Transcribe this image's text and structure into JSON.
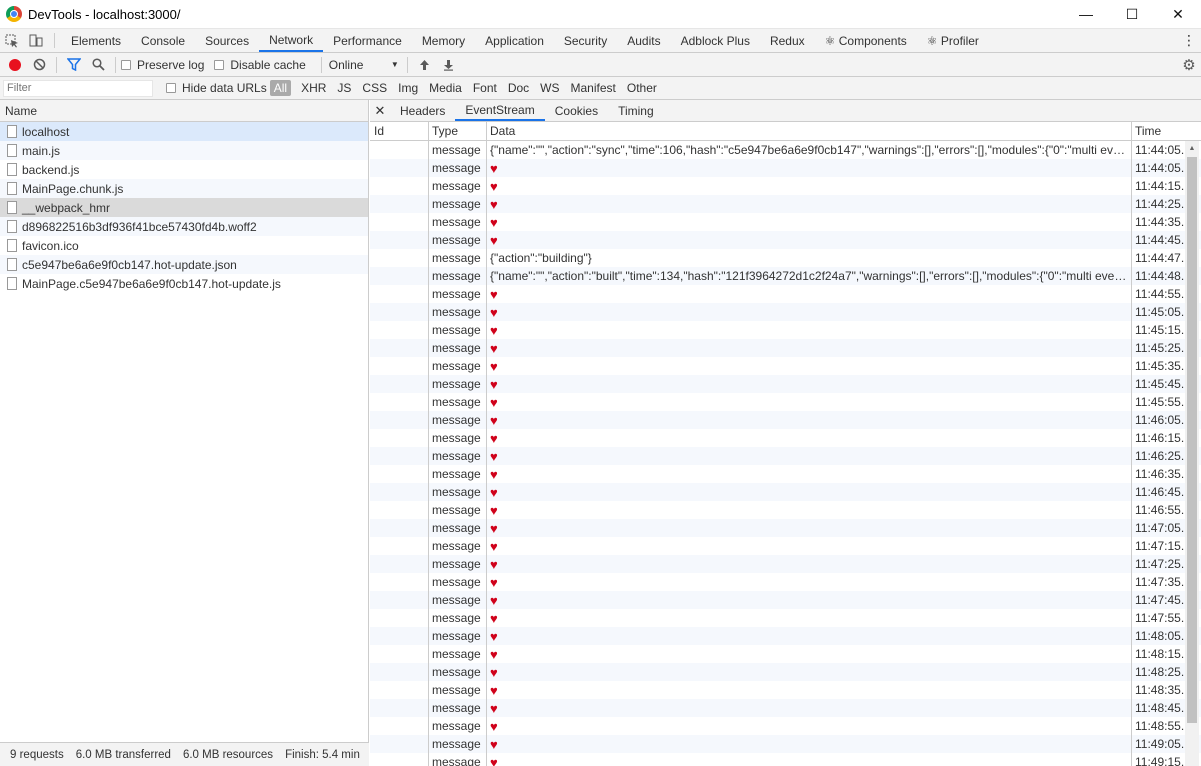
{
  "window": {
    "title": "DevTools - localhost:3000/",
    "minimize": "—",
    "maximize": "☐",
    "close": "✕"
  },
  "tabs": [
    "Elements",
    "Console",
    "Sources",
    "Network",
    "Performance",
    "Memory",
    "Application",
    "Security",
    "Audits",
    "Adblock Plus",
    "Redux",
    "⚛ Components",
    "⚛ Profiler"
  ],
  "active_tab": "Network",
  "toolbar": {
    "preserve_log": "Preserve log",
    "disable_cache": "Disable cache",
    "throttle": "Online"
  },
  "filterbar": {
    "placeholder": "Filter",
    "hide_data_urls": "Hide data URLs",
    "types": [
      "All",
      "XHR",
      "JS",
      "CSS",
      "Img",
      "Media",
      "Font",
      "Doc",
      "WS",
      "Manifest",
      "Other"
    ]
  },
  "requests": {
    "header": "Name",
    "items": [
      "localhost",
      "main.js",
      "backend.js",
      "MainPage.chunk.js",
      "__webpack_hmr",
      "d896822516b3df936f41bce57430fd4b.woff2",
      "favicon.ico",
      "c5e947be6a6e9f0cb147.hot-update.json",
      "MainPage.c5e947be6a6e9f0cb147.hot-update.js"
    ]
  },
  "status": {
    "requests": "9 requests",
    "transferred": "6.0 MB transferred",
    "resources": "6.0 MB resources",
    "finish": "Finish: 5.4 min",
    "more": "D"
  },
  "detail_tabs": [
    "Headers",
    "EventStream",
    "Cookies",
    "Timing"
  ],
  "active_detail_tab": "EventStream",
  "events": {
    "columns": [
      "Id",
      "Type",
      "Data",
      "Time"
    ],
    "rows": [
      {
        "type": "message",
        "data": "{\"name\":\"\",\"action\":\"sync\",\"time\":106,\"hash\":\"c5e947be6a6e9f0cb147\",\"warnings\":[],\"errors\":[],\"modules\":{\"0\":\"multi eventsource-poly...",
        "time": "11:44:05..."
      },
      {
        "type": "message",
        "data": "♥",
        "time": "11:44:05..."
      },
      {
        "type": "message",
        "data": "♥",
        "time": "11:44:15..."
      },
      {
        "type": "message",
        "data": "♥",
        "time": "11:44:25..."
      },
      {
        "type": "message",
        "data": "♥",
        "time": "11:44:35..."
      },
      {
        "type": "message",
        "data": "♥",
        "time": "11:44:45..."
      },
      {
        "type": "message",
        "data": "{\"action\":\"building\"}",
        "time": "11:44:47..."
      },
      {
        "type": "message",
        "data": "{\"name\":\"\",\"action\":\"built\",\"time\":134,\"hash\":\"121f3964272d1c2f24a7\",\"warnings\":[],\"errors\":[],\"modules\":{\"0\":\"multi eventsource-poly...",
        "time": "11:44:48..."
      },
      {
        "type": "message",
        "data": "♥",
        "time": "11:44:55..."
      },
      {
        "type": "message",
        "data": "♥",
        "time": "11:45:05..."
      },
      {
        "type": "message",
        "data": "♥",
        "time": "11:45:15..."
      },
      {
        "type": "message",
        "data": "♥",
        "time": "11:45:25..."
      },
      {
        "type": "message",
        "data": "♥",
        "time": "11:45:35..."
      },
      {
        "type": "message",
        "data": "♥",
        "time": "11:45:45..."
      },
      {
        "type": "message",
        "data": "♥",
        "time": "11:45:55..."
      },
      {
        "type": "message",
        "data": "♥",
        "time": "11:46:05..."
      },
      {
        "type": "message",
        "data": "♥",
        "time": "11:46:15..."
      },
      {
        "type": "message",
        "data": "♥",
        "time": "11:46:25..."
      },
      {
        "type": "message",
        "data": "♥",
        "time": "11:46:35..."
      },
      {
        "type": "message",
        "data": "♥",
        "time": "11:46:45..."
      },
      {
        "type": "message",
        "data": "♥",
        "time": "11:46:55..."
      },
      {
        "type": "message",
        "data": "♥",
        "time": "11:47:05..."
      },
      {
        "type": "message",
        "data": "♥",
        "time": "11:47:15..."
      },
      {
        "type": "message",
        "data": "♥",
        "time": "11:47:25..."
      },
      {
        "type": "message",
        "data": "♥",
        "time": "11:47:35..."
      },
      {
        "type": "message",
        "data": "♥",
        "time": "11:47:45..."
      },
      {
        "type": "message",
        "data": "♥",
        "time": "11:47:55..."
      },
      {
        "type": "message",
        "data": "♥",
        "time": "11:48:05..."
      },
      {
        "type": "message",
        "data": "♥",
        "time": "11:48:15..."
      },
      {
        "type": "message",
        "data": "♥",
        "time": "11:48:25..."
      },
      {
        "type": "message",
        "data": "♥",
        "time": "11:48:35..."
      },
      {
        "type": "message",
        "data": "♥",
        "time": "11:48:45..."
      },
      {
        "type": "message",
        "data": "♥",
        "time": "11:48:55..."
      },
      {
        "type": "message",
        "data": "♥",
        "time": "11:49:05..."
      },
      {
        "type": "message",
        "data": "♥",
        "time": "11:49:15..."
      }
    ]
  },
  "icons": {
    "inspect": "inspect-icon",
    "device": "device-toolbar-icon",
    "record": "record-icon",
    "clear": "clear-icon",
    "filter": "filter-icon",
    "search": "search-icon",
    "import": "import-har-icon",
    "export": "export-har-icon",
    "settings": "gear-icon",
    "more": "kebab-menu-icon"
  },
  "colors": {
    "accent": "#1a73e8",
    "record": "#e8111f",
    "heart": "#d0021b"
  }
}
